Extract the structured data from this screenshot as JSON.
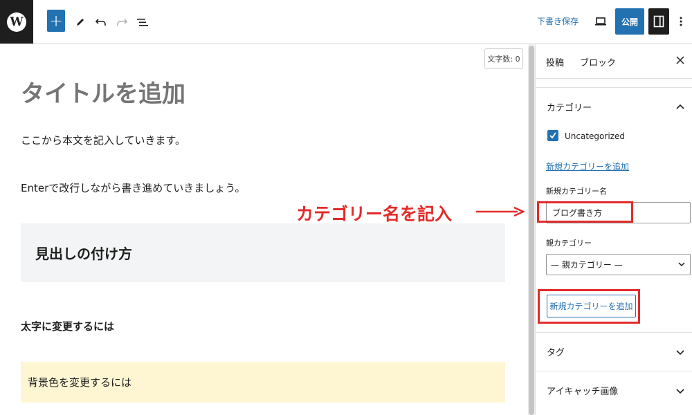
{
  "toolbar": {
    "logo_text": "W",
    "save_draft_label": "下書き保存",
    "publish_label": "公開"
  },
  "editor": {
    "word_count": "文字数: 0",
    "title_placeholder": "タイトルを追加",
    "paragraph1": "ここから本文を記入していきます。",
    "paragraph2": "Enterで改行しながら書き進めていきましょう。",
    "heading": "見出しの付け方",
    "bold_text": "太字に変更するには",
    "highlight_text": "背景色を変更するには"
  },
  "annotation": {
    "text": "カテゴリー名を記入",
    "color": "#e32a2a"
  },
  "sidebar": {
    "tabs": [
      {
        "label": "投稿",
        "active": true
      },
      {
        "label": "ブロック",
        "active": false
      }
    ],
    "close_icon": "close-icon",
    "category_panel": {
      "title": "カテゴリー",
      "expanded": true,
      "items": [
        {
          "label": "Uncategorized",
          "checked": true
        }
      ],
      "add_link": "新規カテゴリーを追加",
      "new_name_label": "新規カテゴリー名",
      "new_name_value": "ブログ書き方",
      "parent_label": "親カテゴリー",
      "parent_selected": "— 親カテゴリー —",
      "add_button": "新規カテゴリーを追加"
    },
    "tag_panel": {
      "title": "タグ",
      "expanded": false
    },
    "featured_panel": {
      "title": "アイキャッチ画像",
      "expanded": false
    }
  },
  "colors": {
    "accent": "#2271b1",
    "dark": "#1e1e1e",
    "highlight_bg": "#fef6d3",
    "heading_bg": "#f3f4f5"
  }
}
